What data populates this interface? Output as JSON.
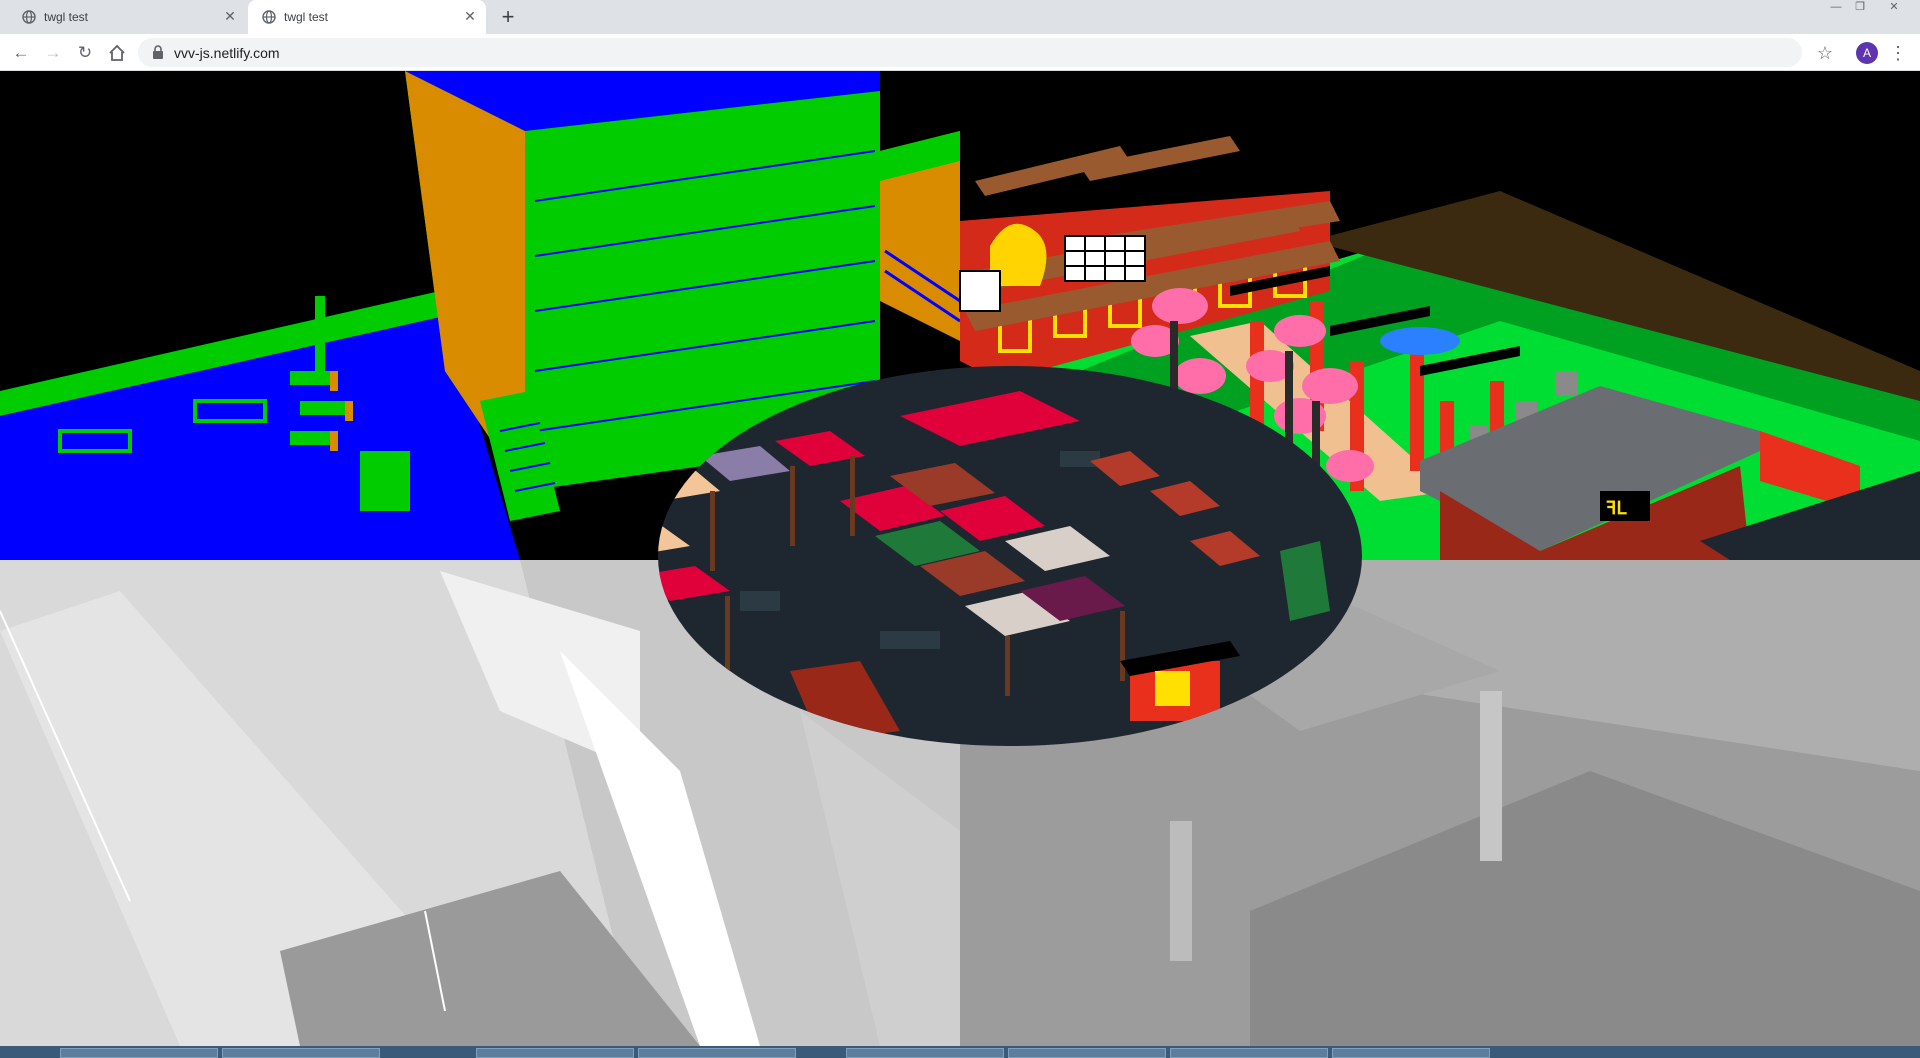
{
  "browser": {
    "tabs": [
      {
        "title": "twgl test",
        "active": false
      },
      {
        "title": "twgl test",
        "active": true
      }
    ],
    "new_tab_label": "+",
    "address": "vvv-js.netlify.com",
    "profile_initial": "A"
  },
  "icons": {
    "favicon": "globe-icon",
    "close": "close-icon",
    "back": "back-arrow-icon",
    "forward": "forward-arrow-icon",
    "reload": "reload-icon",
    "home": "home-icon",
    "lock": "lock-icon",
    "bookmark": "star-icon",
    "menu": "kebab-menu-icon"
  },
  "colors": {
    "chrome_bg": "#dee1e6",
    "toolbar_bg": "#ffffff",
    "omnibox_bg": "#f1f3f4",
    "avatar": "#5e35b1",
    "voxel_blue": "#0000ff",
    "voxel_green": "#00cc00",
    "voxel_orange": "#d98c00",
    "depth_gray": "#b4b4b4",
    "market_dark": "#1e2630",
    "roof_red": "#e0003a"
  }
}
